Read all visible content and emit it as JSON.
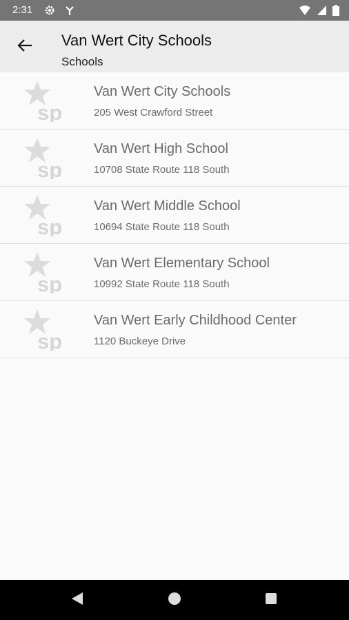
{
  "status_bar": {
    "time": "2:31",
    "left_icons": [
      "gear-icon",
      "fan-icon"
    ],
    "right_icons": [
      "wifi-icon",
      "signal-icon",
      "battery-icon"
    ]
  },
  "app_bar": {
    "title": "Van Wert City Schools",
    "subtitle": "Schools",
    "back_icon": "arrow-left-icon"
  },
  "schools": [
    {
      "name": "Van Wert City Schools",
      "address": "205 West Crawford Street",
      "logo_text": "sp"
    },
    {
      "name": "Van Wert High School",
      "address": "10708 State Route 118 South",
      "logo_text": "sp"
    },
    {
      "name": "Van Wert Middle School",
      "address": "10694 State Route 118 South",
      "logo_text": "sp"
    },
    {
      "name": "Van Wert Elementary School",
      "address": "10992 State Route 118 South",
      "logo_text": "sp"
    },
    {
      "name": "Van Wert Early Childhood Center",
      "address": "1120 Buckeye Drive",
      "logo_text": "sp"
    }
  ],
  "nav_bar": {
    "buttons": [
      "back-triangle-icon",
      "home-circle-icon",
      "recents-square-icon"
    ]
  },
  "colors": {
    "status_bar": "#757575",
    "app_bar": "#ececec",
    "logo": "#d9d9d9",
    "text_secondary": "#6b6b6b"
  }
}
